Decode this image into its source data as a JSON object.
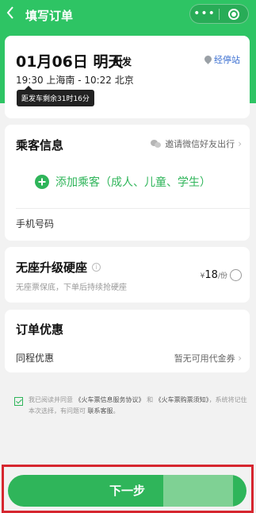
{
  "navbar": {
    "back_icon": "chevron-left-icon",
    "title": "填写订单",
    "capsule_more": "•••"
  },
  "trip": {
    "date": "01月06日 明天",
    "depart_label": "出发",
    "stops_link": "经停站",
    "times": "19:30 上海南 - 10:22 北京",
    "countdown": "距发车剩余31时16分"
  },
  "passenger": {
    "title": "乘客信息",
    "invite": "邀请微信好友出行",
    "add_label": "添加乘客（成人、儿童、学生）",
    "phone_label": "手机号码"
  },
  "seat_upgrade": {
    "title": "无座升级硬座",
    "description": "无座票保底，下单后持续抢硬座",
    "price_symbol": "¥",
    "price": "18",
    "price_unit": "/份"
  },
  "discount": {
    "title": "订单优惠",
    "coupon_label": "同程优惠",
    "coupon_value": "暂无可用代金券"
  },
  "agreement": {
    "prefix": "我已阅读并同意",
    "link1": "《火车票信息服务协议》",
    "middle": "和",
    "link2": "《火车票购票须知》",
    "suffix": "，系统将记住本次选择，有问题可",
    "contact": "联系客服",
    "end": "。"
  },
  "footer": {
    "next_label": "下一步"
  },
  "colors": {
    "brand_green": "#2ec464",
    "highlight_red": "#d6262f"
  }
}
